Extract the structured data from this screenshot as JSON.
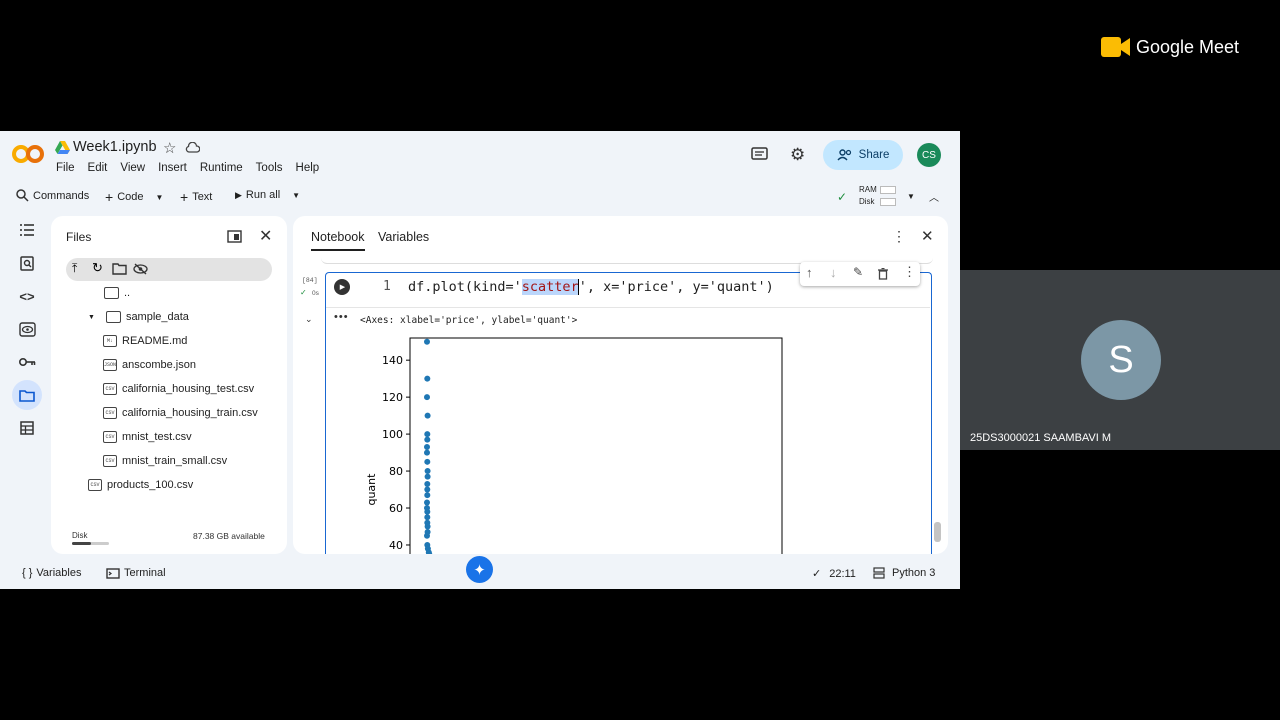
{
  "meet": {
    "brand": "Google Meet",
    "participant_name": "25DS3000021 SAAMBAVI M",
    "participant_initial": "S"
  },
  "colab": {
    "notebook_title": "Week1.ipynb",
    "menu": [
      "File",
      "Edit",
      "View",
      "Insert",
      "Runtime",
      "Tools",
      "Help"
    ],
    "toolbar": {
      "commands": "Commands",
      "code": "Code",
      "text": "Text",
      "run_all": "Run all",
      "ram": "RAM",
      "disk": "Disk"
    },
    "share_label": "Share",
    "user_initials": "CS",
    "files_panel": {
      "title": "Files",
      "items": [
        {
          "name": "..",
          "type": "folder"
        },
        {
          "name": "sample_data",
          "type": "folder"
        },
        {
          "name": "README.md",
          "type": "M↓"
        },
        {
          "name": "anscombe.json",
          "type": "JSON"
        },
        {
          "name": "california_housing_test.csv",
          "type": "CSV"
        },
        {
          "name": "california_housing_train.csv",
          "type": "CSV"
        },
        {
          "name": "mnist_test.csv",
          "type": "CSV"
        },
        {
          "name": "mnist_train_small.csv",
          "type": "CSV"
        },
        {
          "name": "products_100.csv",
          "type": "CSV"
        }
      ],
      "disk_label": "Disk",
      "disk_available": "87.38 GB available",
      "disk_used_fraction": 0.5
    },
    "tabs": [
      "Notebook",
      "Variables"
    ],
    "cell": {
      "exec_count": "[84]",
      "exec_time": "0s",
      "line_number": "1",
      "code_prefix": "df.plot(kind='",
      "code_selected": "scatter",
      "code_suffix": "', x='price', y='quant')",
      "output_text": "<Axes: xlabel='price', ylabel='quant'>"
    },
    "statusbar": {
      "variables": "Variables",
      "terminal": "Terminal",
      "time": "22:11",
      "kernel": "Python 3"
    },
    "accent": "#1967d2"
  },
  "chart_data": {
    "type": "scatter",
    "ylabel": "quant",
    "xlabel": "",
    "y_ticks": [
      40,
      60,
      80,
      100,
      120,
      140
    ],
    "ylim": [
      27,
      152
    ],
    "points_y": [
      150,
      130,
      120,
      110,
      100,
      97,
      93,
      90,
      85,
      80,
      77,
      73,
      70,
      67,
      63,
      60,
      58,
      55,
      52,
      50,
      47,
      45,
      40,
      38,
      36,
      35,
      33,
      32,
      31,
      30,
      29
    ],
    "point_color": "#1f77b4"
  }
}
